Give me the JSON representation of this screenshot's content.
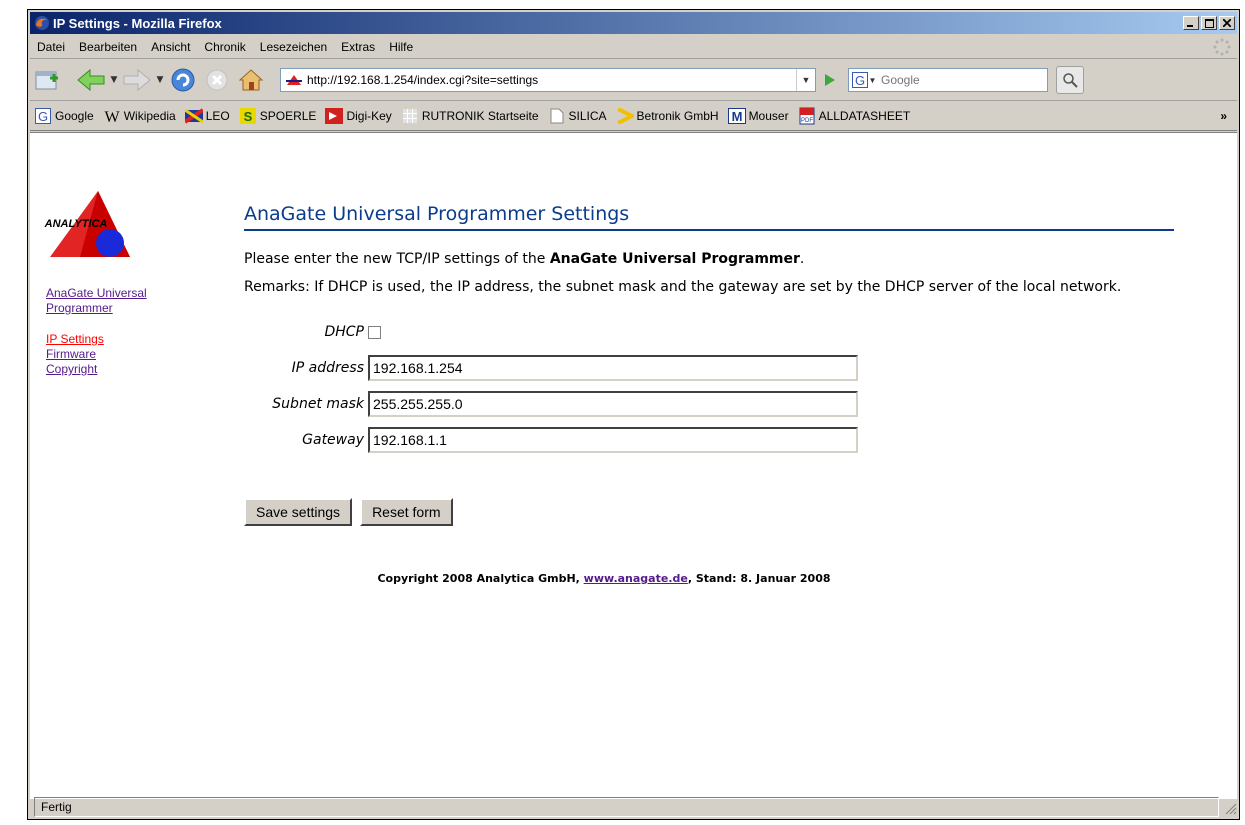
{
  "window": {
    "title": "IP Settings - Mozilla Firefox"
  },
  "menubar": {
    "items": [
      "Datei",
      "Bearbeiten",
      "Ansicht",
      "Chronik",
      "Lesezeichen",
      "Extras",
      "Hilfe"
    ]
  },
  "navbar": {
    "url": "http://192.168.1.254/index.cgi?site=settings",
    "search_placeholder": "Google"
  },
  "bookmarks": [
    "Google",
    "Wikipedia",
    "LEO",
    "SPOERLE",
    "Digi-Key",
    "RUTRONIK Startseite",
    "SILICA",
    "Betronik GmbH",
    "Mouser",
    "ALLDATASHEET"
  ],
  "bookmarks_more": "»",
  "sidebar": {
    "logo_text": "ANALYTICA",
    "links": [
      "AnaGate Universal Programmer",
      "IP Settings",
      "Firmware",
      "Copyright"
    ]
  },
  "page": {
    "title": "AnaGate Universal Programmer Settings",
    "intro_prefix": "Please enter the new TCP/IP settings of the ",
    "intro_bold": "AnaGate Universal Programmer",
    "intro_suffix": ".",
    "remarks": "Remarks: If DHCP is used, the IP address, the subnet mask and the gateway are set by the DHCP server of the local network."
  },
  "form": {
    "dhcp_label": "DHCP",
    "dhcp_checked": false,
    "ip_label": "IP address",
    "ip_value": "192.168.1.254",
    "subnet_label": "Subnet mask",
    "subnet_value": "255.255.255.0",
    "gateway_label": "Gateway",
    "gateway_value": "192.168.1.1",
    "save_label": "Save settings",
    "reset_label": "Reset form"
  },
  "footer": {
    "prefix": "Copyright 2008 Analytica GmbH, ",
    "link": "www.anagate.de",
    "suffix": ", Stand: 8. Januar 2008"
  },
  "status": "Fertig",
  "colors": {
    "title_bar": "#0a246a",
    "heading": "#0b3c8c",
    "active_link": "#ff0000",
    "visited_link": "#551a8b"
  }
}
